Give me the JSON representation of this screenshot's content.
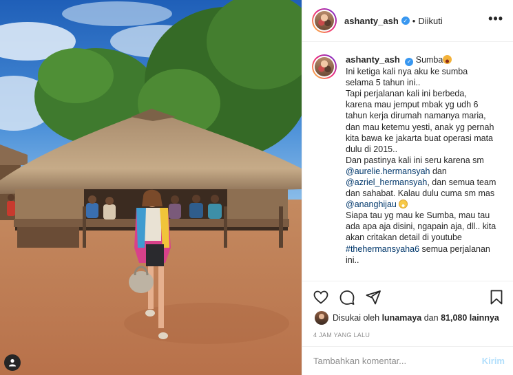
{
  "post": {
    "username": "ashanty_ash",
    "verified_mark": "✓",
    "separator": "•",
    "follow_state": "Diikuti",
    "more_label": "•••"
  },
  "caption": {
    "username": "ashanty_ash",
    "lines": [
      {
        "text": "Ini ketiga kali nya aku ke sumba"
      },
      {
        "text": "selama 5 tahun ini.."
      },
      {
        "text": "Tapi perjalanan kali ini berbeda,"
      },
      {
        "text": "karena mau jemput mbak yg udh 6"
      },
      {
        "text": "tahun kerja dirumah namanya maria,"
      },
      {
        "text": "dan mau ketemu yesti, anak yg pernah"
      },
      {
        "text": "kita bawa ke jakarta buat operasi mata"
      },
      {
        "text": "dulu di 2015.."
      },
      {
        "text": "Dan pastinya kali ini seru karena sm"
      },
      {
        "link": "@aurelie.hermansyah",
        "text": " dan"
      },
      {
        "link": "@azriel_hermansyah",
        "text": ", dan semua team"
      },
      {
        "text": "dan sahabat. Kalau dulu cuma sm mas"
      },
      {
        "link": "@ananghijau",
        "text": " ",
        "emoji": "smile"
      },
      {
        "text": "Siapa tau yg mau ke Sumba, mau tau"
      },
      {
        "text": "ada apa aja disini, ngapain aja, dll.. kita"
      },
      {
        "text": "akan critakan detail di youtube"
      },
      {
        "link": "#thehermansyaha6",
        "text": " semua perjalanan"
      },
      {
        "text": "ini.."
      }
    ],
    "first_word": "Sumba"
  },
  "actions": {
    "like_icon": "heart-icon",
    "comment_icon": "comment-icon",
    "share_icon": "paper-plane-icon",
    "save_icon": "bookmark-icon"
  },
  "likes": {
    "prefix": "Disukai oleh",
    "user": "lunamaya",
    "middle": "dan",
    "count": "81,080 lainnya"
  },
  "timestamp": "4 JAM YANG LALU",
  "comment_box": {
    "placeholder": "Tambahkan komentar...",
    "post_label": "Kirim"
  },
  "colors": {
    "link": "#00376b",
    "verified": "#3897f0",
    "post_button_disabled": "#b2dffc",
    "muted": "#8e8e8e"
  }
}
